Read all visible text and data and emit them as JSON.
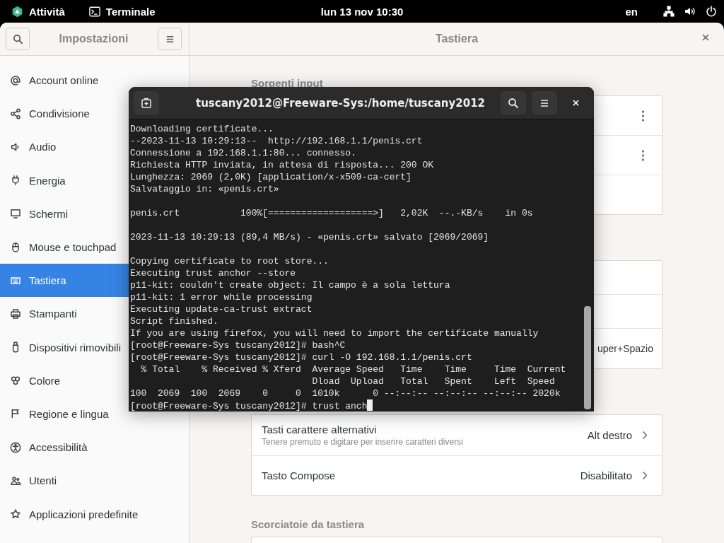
{
  "top_bar": {
    "activities": "Attività",
    "app": "Terminale",
    "clock": "lun 13 nov  10:30",
    "input_source": "en"
  },
  "settings": {
    "sidebar_title": "Impostazioni",
    "panel_title": "Tastiera",
    "sidebar_items": [
      {
        "label": "Account online",
        "selected": false
      },
      {
        "label": "Condivisione",
        "selected": false
      },
      {
        "label": "Audio",
        "selected": false
      },
      {
        "label": "Energia",
        "selected": false
      },
      {
        "label": "Schermi",
        "selected": false
      },
      {
        "label": "Mouse e touchpad",
        "selected": false
      },
      {
        "label": "Tastiera",
        "selected": true
      },
      {
        "label": "Stampanti",
        "selected": false
      },
      {
        "label": "Dispositivi rimovibili",
        "selected": false
      },
      {
        "label": "Colore",
        "selected": false
      },
      {
        "label": "Regione e lingua",
        "selected": false
      },
      {
        "label": "Accessibilità",
        "selected": false
      },
      {
        "label": "Utenti",
        "selected": false
      },
      {
        "label": "Applicazioni predefinite",
        "selected": false
      }
    ],
    "sections": [
      {
        "title": "Sorgenti input",
        "rows": [
          {
            "kind": "menu"
          },
          {
            "kind": "menu"
          },
          {
            "kind": "blank"
          }
        ]
      },
      {
        "rows": [
          {
            "kind": "blank"
          },
          {
            "kind": "blank"
          },
          {
            "kind": "value",
            "value": "uper+Spazio"
          }
        ]
      },
      {
        "rows": [
          {
            "kind": "link",
            "label": "Tasti carattere alternativi",
            "subtitle": "Tenere premuto e digitare per inserire caratteri diversi",
            "value": "Alt destro"
          },
          {
            "kind": "link",
            "label": "Tasto Compose",
            "value": "Disabilitato"
          }
        ]
      },
      {
        "title": "Scorciatoie da tastiera",
        "rows": [
          {
            "kind": "blank"
          }
        ]
      }
    ]
  },
  "terminal": {
    "title": "tuscany2012@Freeware-Sys:/home/tuscany2012",
    "cursor": true,
    "blocks": [
      [
        "Downloading certificate...",
        "--2023-11-13 10:29:13--  http://192.168.1.1/penis.crt",
        "Connessione a 192.168.1.1:80... connesso.",
        "Richiesta HTTP inviata, in attesa di risposta... 200 OK",
        "Lunghezza: 2069 (2,0K) [application/x-x509-ca-cert]",
        "Salvataggio in: «penis.crt»"
      ],
      [
        "penis.crt           100%[===================>]   2,02K  --.-KB/s    in 0s"
      ],
      [
        "2023-11-13 10:29:13 (89,4 MB/s) - «penis.crt» salvato [2069/2069]"
      ],
      [
        "Copying certificate to root store...",
        "Executing trust anchor --store",
        "p11-kit: couldn't create object: Il campo è a sola lettura",
        "p11-kit: 1 error while processing",
        "Executing update-ca-trust extract",
        "Script finished.",
        "If you are using firefox, you will need to import the certificate manually",
        "[root@Freeware-Sys tuscany2012]# bash^C",
        "[root@Freeware-Sys tuscany2012]# curl -O 192.168.1.1/penis.crt",
        "  % Total    % Received % Xferd  Average Speed   Time    Time     Time  Current",
        "                                 Dload  Upload   Total   Spent    Left  Speed",
        "100  2069  100  2069    0     0  1010k      0 --:--:-- --:--:-- --:--:-- 2020k",
        "[root@Freeware-Sys tuscany2012]# trust anch"
      ]
    ]
  }
}
